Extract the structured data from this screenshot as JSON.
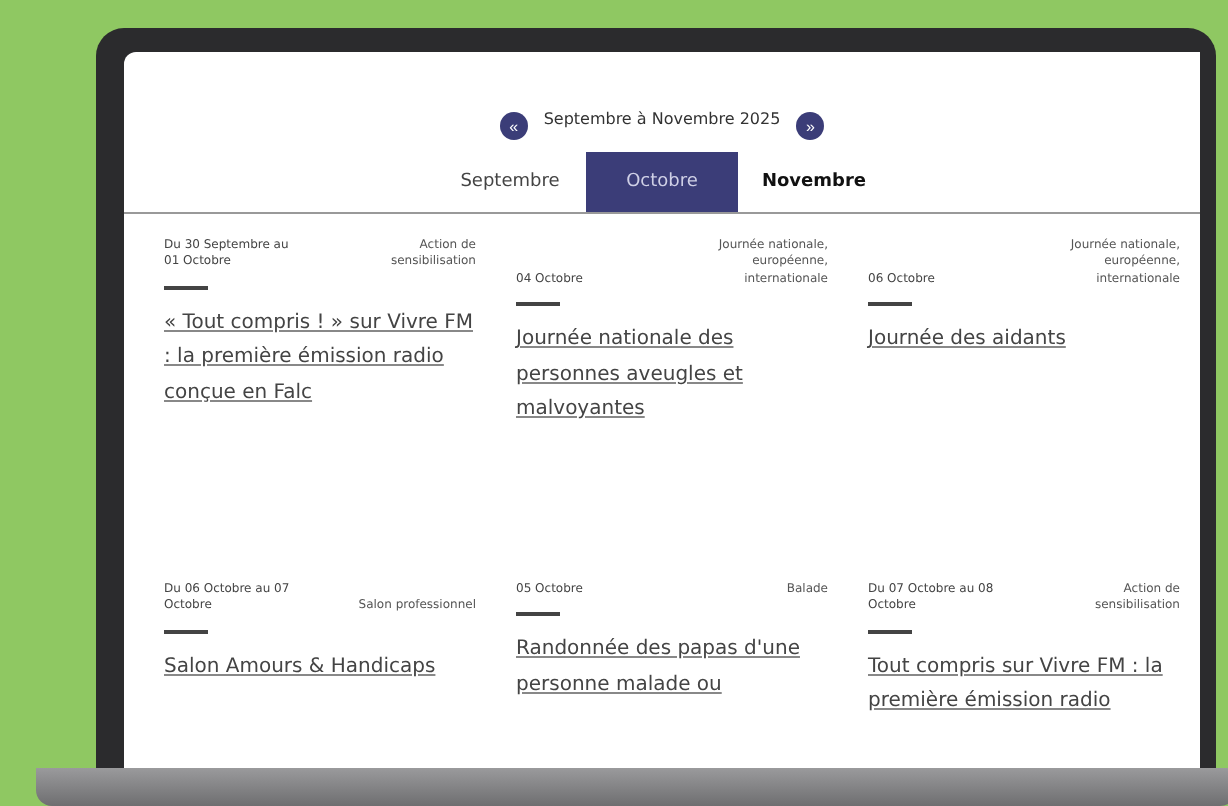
{
  "header": {
    "title": "Septembre à Novembre 2025",
    "prev_label": "«",
    "next_label": "»"
  },
  "tabs": [
    {
      "label": "Septembre",
      "selected": false
    },
    {
      "label": "Octobre",
      "selected": true
    },
    {
      "label": "Novembre",
      "selected": false
    }
  ],
  "events": [
    {
      "date": "Du 30 Septembre au 01 Octobre",
      "type": "Action de sensibilisation",
      "title": "« Tout compris ! » sur Vivre FM : la première émission radio conçue en Falc"
    },
    {
      "date": "04 Octobre",
      "type": "Journée nationale, européenne, internationale",
      "title": "Journée nationale des personnes aveugles et malvoyantes"
    },
    {
      "date": "06 Octobre",
      "type": "Journée nationale, européenne, internationale",
      "title": "Journée des aidants"
    },
    {
      "date": "Du 06 Octobre au 07 Octobre",
      "type": "Salon professionnel",
      "title": "Salon Amours & Handicaps"
    },
    {
      "date": "05 Octobre",
      "type": "Balade",
      "title": "Randonnée des papas d'une personne malade ou"
    },
    {
      "date": "Du 07 Octobre au 08 Octobre",
      "type": "Action de sensibilisation",
      "title": "Tout compris sur Vivre FM : la première émission radio"
    }
  ]
}
